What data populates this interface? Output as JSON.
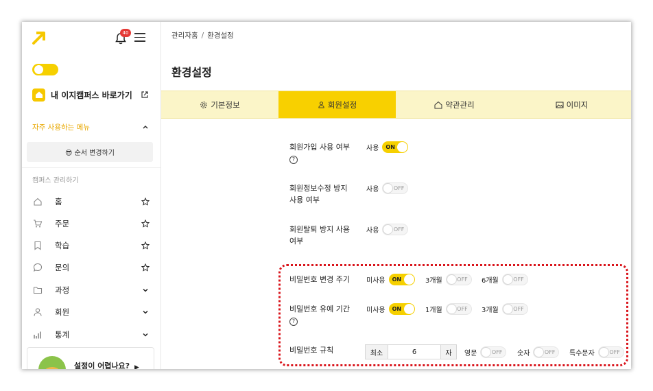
{
  "sidebar": {
    "notification_count": "40",
    "campus_link": "내 이지캠퍼스 바로가기",
    "favorites_title": "자주 사용하는 메뉴",
    "reorder_button": "😎 순서 변경하기",
    "management_title": "캠퍼스 관리하기",
    "items": [
      {
        "label": "홈",
        "icon": "home-icon",
        "tail": "star"
      },
      {
        "label": "주문",
        "icon": "cart-icon",
        "tail": "star"
      },
      {
        "label": "학습",
        "icon": "bookmark-icon",
        "tail": "star"
      },
      {
        "label": "문의",
        "icon": "chat-icon",
        "tail": "star"
      },
      {
        "label": "과정",
        "icon": "folder-icon",
        "tail": "chevron"
      },
      {
        "label": "회원",
        "icon": "user-icon",
        "tail": "chevron"
      },
      {
        "label": "통계",
        "icon": "bar-chart-icon",
        "tail": "chevron"
      }
    ],
    "help_text": "설정이 어렵나요?"
  },
  "breadcrumb": {
    "root": "관리자홈",
    "separator": "/",
    "current": "환경설정"
  },
  "page_title": "환경설정",
  "tabs": [
    {
      "label": "기본정보",
      "icon": "gear-icon"
    },
    {
      "label": "회원설정",
      "icon": "user-icon"
    },
    {
      "label": "약관관리",
      "icon": "home-icon"
    },
    {
      "label": "이미지",
      "icon": "image-icon"
    }
  ],
  "active_tab": "회원설정",
  "settings": {
    "signup": {
      "label": "회원가입 사용 여부",
      "opt_label": "사용",
      "state": "ON"
    },
    "edit_block": {
      "label1": "회원정보수정 방지",
      "label2": "사용 여부",
      "opt_label": "사용",
      "state": "OFF"
    },
    "withdraw_block": {
      "label1": "회원탈퇴 방지 사용",
      "label2": "여부",
      "opt_label": "사용",
      "state": "OFF"
    },
    "pw_change": {
      "label": "비밀번호 변경 주기",
      "options": [
        {
          "label": "미사용",
          "state": "ON"
        },
        {
          "label": "3개월",
          "state": "OFF"
        },
        {
          "label": "6개월",
          "state": "OFF"
        }
      ]
    },
    "pw_grace": {
      "label": "비밀번호 유예 기간",
      "options": [
        {
          "label": "미사용",
          "state": "ON"
        },
        {
          "label": "1개월",
          "state": "OFF"
        },
        {
          "label": "3개월",
          "state": "OFF"
        }
      ]
    },
    "pw_rule": {
      "label": "비밀번호 규칙",
      "min_prefix": "최소",
      "min_value": "6",
      "min_suffix": "자",
      "options": [
        {
          "label": "영문",
          "state": "OFF"
        },
        {
          "label": "숫자",
          "state": "OFF"
        },
        {
          "label": "특수문자",
          "state": "OFF"
        }
      ]
    }
  },
  "colors": {
    "accent": "#f6d000",
    "highlight_border": "#d9141b",
    "tab_bg": "#fbf5c8"
  }
}
